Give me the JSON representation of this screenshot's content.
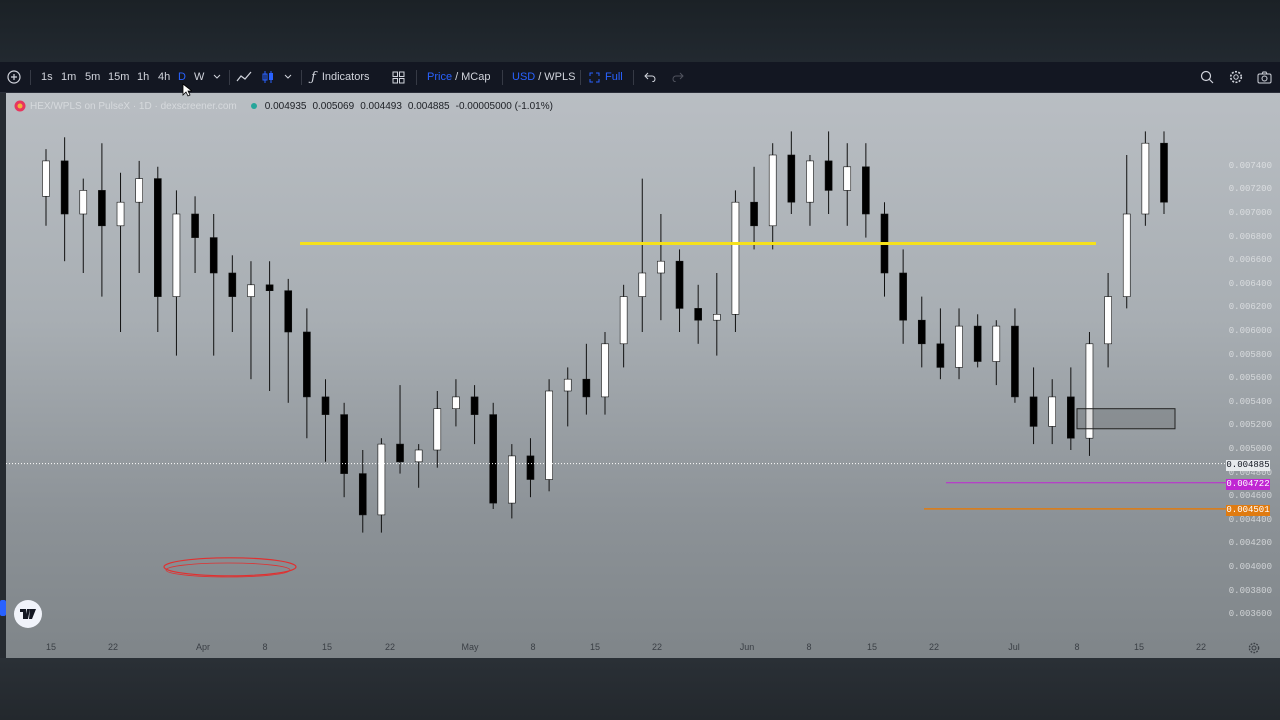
{
  "colors": {
    "accent": "#2962ff",
    "toolbar_bg": "#131722",
    "bull_candle": "#ffffff",
    "bear_candle": "#0b0b0b",
    "horizontal_line": "#f5e11b",
    "support_line": "#e07b10",
    "purple_line": "#c026d3",
    "annotation_circle": "#e03030"
  },
  "toolbar": {
    "timeframes": [
      "1s",
      "1m",
      "5m",
      "15m",
      "1h",
      "4h",
      "D",
      "W"
    ],
    "active_timeframe": "D",
    "indicators_label": "Indicators",
    "price_label": "Price",
    "slash": "/",
    "mcap_label": "MCap",
    "currency_label": "USD",
    "pair_quote_label": "WPLS",
    "full_label": "Full"
  },
  "legend": {
    "symbol": "HEX/WPLS on PulseX · 1D · dexscreener.com",
    "open": "0.004935",
    "high": "0.005069",
    "low": "0.004493",
    "close": "0.004885",
    "change": "-0.00005000 (-1.01%)"
  },
  "price_axis": {
    "ticks": [
      "0.007400",
      "0.007200",
      "0.007000",
      "0.006800",
      "0.006600",
      "0.006400",
      "0.006200",
      "0.006000",
      "0.005800",
      "0.005600",
      "0.005400",
      "0.005200",
      "0.005000",
      "0.004800",
      "0.004600",
      "0.004400",
      "0.004200",
      "0.004000",
      "0.003800",
      "0.003600"
    ],
    "current_price_tag": "0.004885",
    "purple_tag": "0.004722",
    "orange_tag": "0.004501"
  },
  "time_axis": {
    "labels": [
      "15",
      "22",
      "Apr",
      "8",
      "15",
      "22",
      "May",
      "8",
      "15",
      "22",
      "Jun",
      "8",
      "15",
      "22",
      "Jul",
      "8",
      "15",
      "22"
    ]
  },
  "chart_data": {
    "type": "candlestick",
    "bull_color": "white",
    "bear_color": "black",
    "candles": [
      {
        "o": 0.00715,
        "h": 0.00755,
        "l": 0.0069,
        "c": 0.00745
      },
      {
        "o": 0.00745,
        "h": 0.00765,
        "l": 0.0066,
        "c": 0.007
      },
      {
        "o": 0.007,
        "h": 0.0073,
        "l": 0.0065,
        "c": 0.0072
      },
      {
        "o": 0.0072,
        "h": 0.0076,
        "l": 0.0063,
        "c": 0.0069
      },
      {
        "o": 0.0069,
        "h": 0.00735,
        "l": 0.006,
        "c": 0.0071
      },
      {
        "o": 0.0071,
        "h": 0.00745,
        "l": 0.0065,
        "c": 0.0073
      },
      {
        "o": 0.0073,
        "h": 0.0074,
        "l": 0.006,
        "c": 0.0063
      },
      {
        "o": 0.0063,
        "h": 0.0072,
        "l": 0.0058,
        "c": 0.007
      },
      {
        "o": 0.007,
        "h": 0.00715,
        "l": 0.0065,
        "c": 0.0068
      },
      {
        "o": 0.0068,
        "h": 0.007,
        "l": 0.0058,
        "c": 0.0065
      },
      {
        "o": 0.0065,
        "h": 0.00665,
        "l": 0.006,
        "c": 0.0063
      },
      {
        "o": 0.0063,
        "h": 0.0066,
        "l": 0.0056,
        "c": 0.0064
      },
      {
        "o": 0.0064,
        "h": 0.0066,
        "l": 0.0055,
        "c": 0.00635
      },
      {
        "o": 0.00635,
        "h": 0.00645,
        "l": 0.0054,
        "c": 0.006
      },
      {
        "o": 0.006,
        "h": 0.0062,
        "l": 0.0051,
        "c": 0.00545
      },
      {
        "o": 0.00545,
        "h": 0.0056,
        "l": 0.0049,
        "c": 0.0053
      },
      {
        "o": 0.0053,
        "h": 0.0054,
        "l": 0.0046,
        "c": 0.0048
      },
      {
        "o": 0.0048,
        "h": 0.005,
        "l": 0.0043,
        "c": 0.00445
      },
      {
        "o": 0.00445,
        "h": 0.0051,
        "l": 0.0043,
        "c": 0.00505
      },
      {
        "o": 0.00505,
        "h": 0.00555,
        "l": 0.0048,
        "c": 0.0049
      },
      {
        "o": 0.0049,
        "h": 0.00505,
        "l": 0.00468,
        "c": 0.005
      },
      {
        "o": 0.005,
        "h": 0.0055,
        "l": 0.00485,
        "c": 0.00535
      },
      {
        "o": 0.00535,
        "h": 0.0056,
        "l": 0.0052,
        "c": 0.00545
      },
      {
        "o": 0.00545,
        "h": 0.00555,
        "l": 0.00505,
        "c": 0.0053
      },
      {
        "o": 0.0053,
        "h": 0.0054,
        "l": 0.0045,
        "c": 0.00455
      },
      {
        "o": 0.00455,
        "h": 0.00505,
        "l": 0.00442,
        "c": 0.00495
      },
      {
        "o": 0.00495,
        "h": 0.0051,
        "l": 0.0046,
        "c": 0.00475
      },
      {
        "o": 0.00475,
        "h": 0.0056,
        "l": 0.00465,
        "c": 0.0055
      },
      {
        "o": 0.0055,
        "h": 0.0057,
        "l": 0.0052,
        "c": 0.0056
      },
      {
        "o": 0.0056,
        "h": 0.0059,
        "l": 0.0053,
        "c": 0.00545
      },
      {
        "o": 0.00545,
        "h": 0.006,
        "l": 0.0053,
        "c": 0.0059
      },
      {
        "o": 0.0059,
        "h": 0.0064,
        "l": 0.0057,
        "c": 0.0063
      },
      {
        "o": 0.0063,
        "h": 0.0073,
        "l": 0.006,
        "c": 0.0065
      },
      {
        "o": 0.0065,
        "h": 0.007,
        "l": 0.0061,
        "c": 0.0066
      },
      {
        "o": 0.0066,
        "h": 0.0067,
        "l": 0.006,
        "c": 0.0062
      },
      {
        "o": 0.0062,
        "h": 0.0064,
        "l": 0.0059,
        "c": 0.0061
      },
      {
        "o": 0.0061,
        "h": 0.0065,
        "l": 0.0058,
        "c": 0.00615
      },
      {
        "o": 0.00615,
        "h": 0.0072,
        "l": 0.006,
        "c": 0.0071
      },
      {
        "o": 0.0071,
        "h": 0.0074,
        "l": 0.0067,
        "c": 0.0069
      },
      {
        "o": 0.0069,
        "h": 0.0076,
        "l": 0.0067,
        "c": 0.0075
      },
      {
        "o": 0.0075,
        "h": 0.0077,
        "l": 0.007,
        "c": 0.0071
      },
      {
        "o": 0.0071,
        "h": 0.0075,
        "l": 0.0069,
        "c": 0.00745
      },
      {
        "o": 0.00745,
        "h": 0.0077,
        "l": 0.007,
        "c": 0.0072
      },
      {
        "o": 0.0072,
        "h": 0.0076,
        "l": 0.0069,
        "c": 0.0074
      },
      {
        "o": 0.0074,
        "h": 0.0076,
        "l": 0.0068,
        "c": 0.007
      },
      {
        "o": 0.007,
        "h": 0.0071,
        "l": 0.0063,
        "c": 0.0065
      },
      {
        "o": 0.0065,
        "h": 0.0067,
        "l": 0.0059,
        "c": 0.0061
      },
      {
        "o": 0.0061,
        "h": 0.0063,
        "l": 0.0057,
        "c": 0.0059
      },
      {
        "o": 0.0059,
        "h": 0.0062,
        "l": 0.0056,
        "c": 0.0057
      },
      {
        "o": 0.0057,
        "h": 0.0062,
        "l": 0.0056,
        "c": 0.00605
      },
      {
        "o": 0.00605,
        "h": 0.00615,
        "l": 0.0057,
        "c": 0.00575
      },
      {
        "o": 0.00575,
        "h": 0.0061,
        "l": 0.00555,
        "c": 0.00605
      },
      {
        "o": 0.00605,
        "h": 0.0062,
        "l": 0.0054,
        "c": 0.00545
      },
      {
        "o": 0.00545,
        "h": 0.0057,
        "l": 0.00505,
        "c": 0.0052
      },
      {
        "o": 0.0052,
        "h": 0.0056,
        "l": 0.00505,
        "c": 0.00545
      },
      {
        "o": 0.00545,
        "h": 0.0057,
        "l": 0.005,
        "c": 0.0051
      },
      {
        "o": 0.0051,
        "h": 0.006,
        "l": 0.00495,
        "c": 0.0059
      },
      {
        "o": 0.0059,
        "h": 0.0065,
        "l": 0.0057,
        "c": 0.0063
      },
      {
        "o": 0.0063,
        "h": 0.0075,
        "l": 0.0062,
        "c": 0.007
      },
      {
        "o": 0.007,
        "h": 0.0077,
        "l": 0.0069,
        "c": 0.0076
      },
      {
        "o": 0.0076,
        "h": 0.0077,
        "l": 0.007,
        "c": 0.0071
      }
    ],
    "horizontal_lines": [
      {
        "price": 0.00675,
        "color": "#f5e11b"
      },
      {
        "price": 0.004885,
        "color": "#ffffff",
        "style": "dotted"
      },
      {
        "price": 0.004722,
        "color": "#c026d3"
      },
      {
        "price": 0.004501,
        "color": "#e07b10"
      }
    ]
  }
}
